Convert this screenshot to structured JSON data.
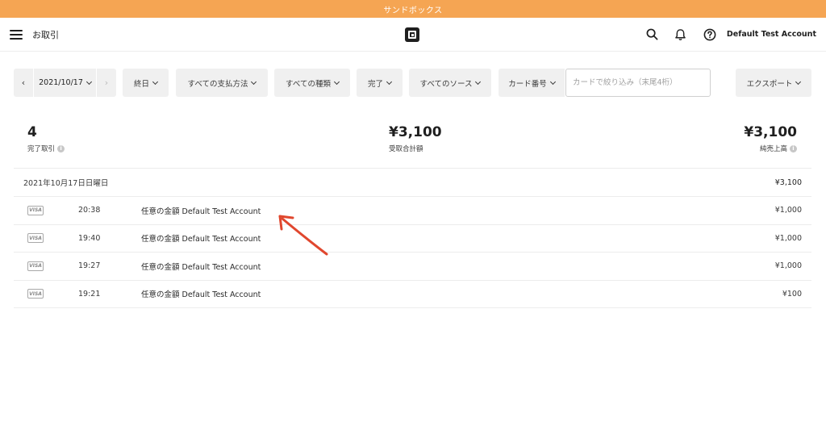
{
  "banner": {
    "text": "サンドボックス"
  },
  "header": {
    "title": "お取引",
    "account_name": "Default Test Account"
  },
  "filters": {
    "date": "2021/10/17",
    "prev_label": "‹",
    "next_label": "›",
    "time_range": "終日",
    "payment_method": "すべての支払方法",
    "type": "すべての種類",
    "status": "完了",
    "source": "すべてのソース",
    "card_number": "カード番号",
    "card_placeholder": "カードで絞り込み（末尾4桁）",
    "export": "エクスポート"
  },
  "stats": {
    "completed_count": "4",
    "completed_label": "完了取引",
    "received_total": "¥3,100",
    "received_label": "受取合計額",
    "net_sales": "¥3,100",
    "net_sales_label": "純売上高",
    "info_icon": "i"
  },
  "day": {
    "date_label": "2021年10月17日日曜日",
    "total": "¥3,100"
  },
  "transactions": [
    {
      "card": "VISA",
      "time": "20:38",
      "description": "任意の金額 Default Test Account",
      "amount": "¥1,000"
    },
    {
      "card": "VISA",
      "time": "19:40",
      "description": "任意の金額 Default Test Account",
      "amount": "¥1,000"
    },
    {
      "card": "VISA",
      "time": "19:27",
      "description": "任意の金額 Default Test Account",
      "amount": "¥1,000"
    },
    {
      "card": "VISA",
      "time": "19:21",
      "description": "任意の金額 Default Test Account",
      "amount": "¥100"
    }
  ],
  "colors": {
    "banner": "#f5a553",
    "annotation_arrow": "#e0472e"
  }
}
